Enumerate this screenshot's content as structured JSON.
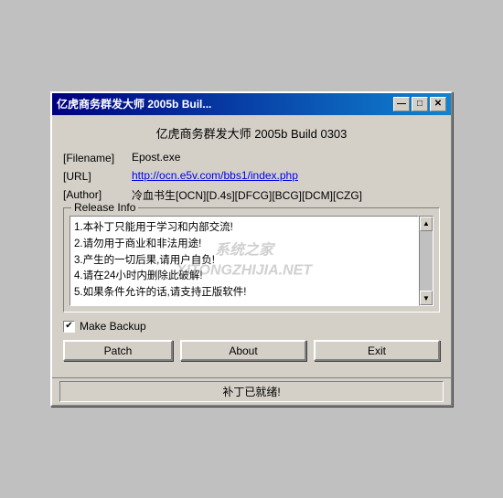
{
  "window": {
    "title": "亿虎商务群发大师 2005b Buil...",
    "minimize_label": "—",
    "maximize_label": "□",
    "close_label": "✕"
  },
  "app_title": "亿虎商务群发大师 2005b Build 0303",
  "fields": {
    "filename_label": "[Filename]",
    "filename_value": "Epost.exe",
    "url_label": "[URL]",
    "url_value": "http://ocn.e5v.com/bbs1/index.php",
    "author_label": "[Author]",
    "author_value": "冷血书生[OCN][D.4s][DFCG][BCG][DCM][CZG]"
  },
  "release": {
    "legend": "Release Info",
    "lines": [
      "1.本补丁只能用于学习和内部交流!",
      "2.请勿用于商业和非法用途!",
      "3.产生的一切后果,请用户自负!",
      "4.请在24小时内删除此破解!",
      "5.如果条件允许的话,请支持正版软件!"
    ],
    "watermark_line1": "系统之家",
    "watermark_line2": "XITONGZHIJIA.NET"
  },
  "checkbox": {
    "label": "Make Backup",
    "checked": true
  },
  "buttons": {
    "patch": "Patch",
    "about": "About",
    "exit": "Exit"
  },
  "status": {
    "text": "补丁已就绪!"
  },
  "icons": {
    "up_arrow": "▲",
    "down_arrow": "▼",
    "check": "✔"
  }
}
